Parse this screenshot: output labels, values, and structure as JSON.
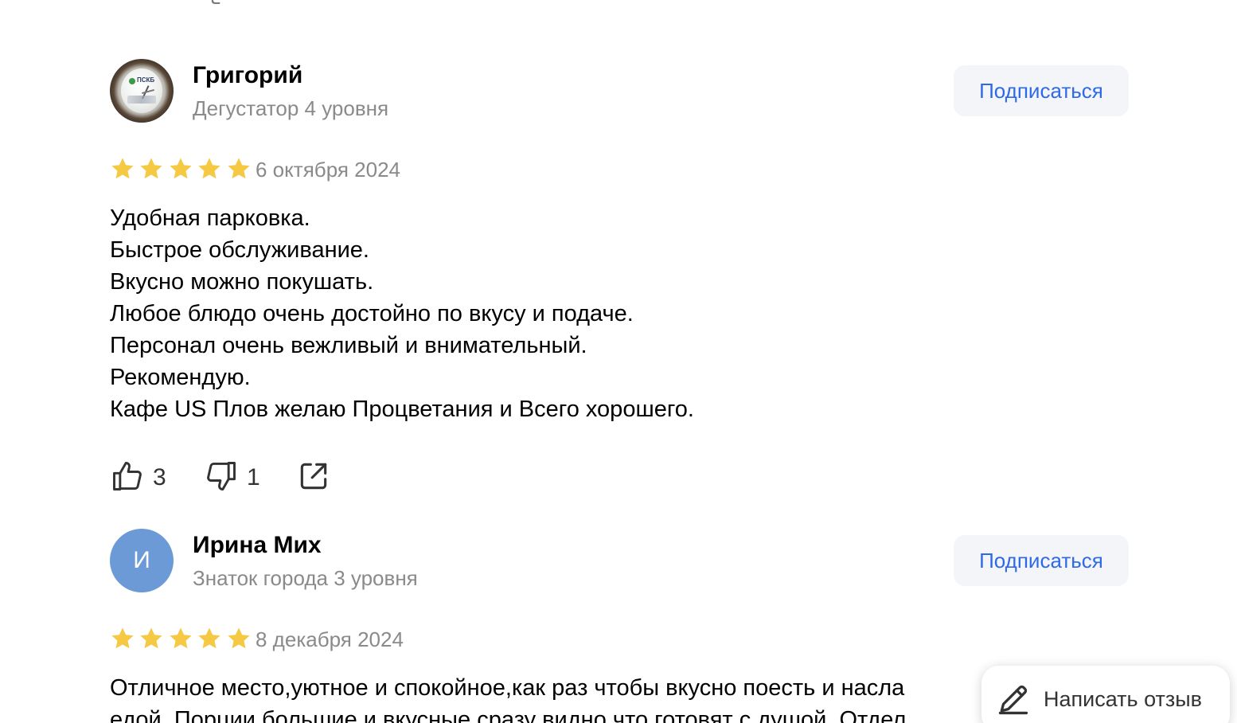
{
  "reviews": [
    {
      "author": {
        "name": "Григорий",
        "level": "Дегустатор 4 уровня",
        "avatar_type": "photo",
        "avatar_photo_text": "ПСКБ"
      },
      "subscribe_label": "Подписаться",
      "rating": 5,
      "date": "6 октября 2024",
      "text_lines": [
        "Удобная парковка.",
        "Быстрое обслуживание.",
        "Вкусно можно покушать.",
        "Любое блюдо очень достойно по вкусу и подаче.",
        "Персонал очень вежливый и внимательный.",
        "Рекомендую.",
        "Кафе US Плов желаю Процветания и Всего хорошего."
      ],
      "likes": "3",
      "dislikes": "1"
    },
    {
      "author": {
        "name": "Ирина Мих",
        "level": "Знаток города 3 уровня",
        "avatar_type": "letter",
        "avatar_letter": "И",
        "avatar_color": "#6b9ad6"
      },
      "subscribe_label": "Подписаться",
      "rating": 5,
      "date": "8 декабря 2024",
      "text_lines": [
        "Отличное место,уютное и спокойное,как раз чтобы вкусно поесть и насла",
        "едой. Порции большие и вкусные,сразу видно что готовят с душой. Отдел"
      ]
    }
  ],
  "write_review": {
    "label": "Написать отзыв",
    "icon": "pencil-icon"
  },
  "colors": {
    "accent_blue": "#2f6ae6",
    "star_yellow": "#f6c945",
    "secondary_text": "#8a8a8a",
    "button_bg": "#f3f5f8"
  }
}
